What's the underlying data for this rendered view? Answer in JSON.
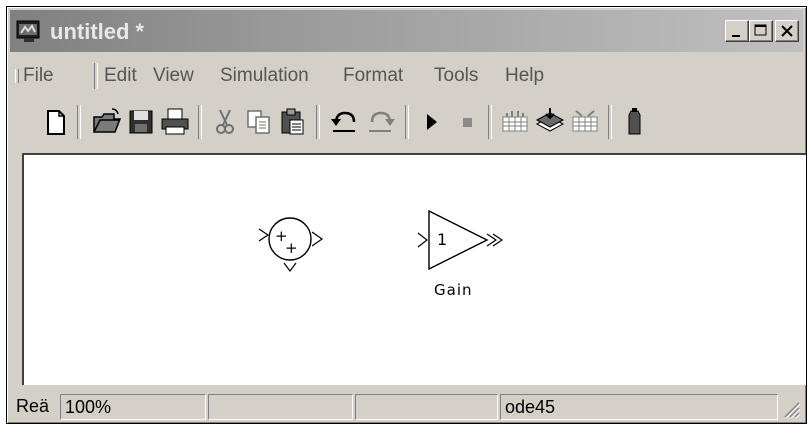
{
  "window": {
    "title": "untitled *"
  },
  "caption_buttons": [
    "minimize",
    "maximize",
    "close"
  ],
  "menubar": {
    "items": [
      "File",
      "Edit",
      "View",
      "Simulation",
      "Format",
      "Tools",
      "Help"
    ]
  },
  "toolbar": {
    "buttons": [
      "new-model",
      "open",
      "save",
      "print",
      "cut",
      "copy",
      "paste",
      "undo",
      "redo",
      "start-simulation",
      "stop-simulation",
      "build",
      "update-diagram",
      "build-subsystem",
      "library-browser"
    ]
  },
  "diagram": {
    "sum_block": {
      "signs": [
        "+",
        "+"
      ]
    },
    "gain_block": {
      "value": "1",
      "name": "Gain"
    }
  },
  "statusbar": {
    "status": "Reä",
    "zoom": "100%",
    "pane2": "",
    "pane3": "",
    "solver": "ode45"
  },
  "colors": {
    "face": "#d4d0c8",
    "title_inactive_start": "#808080",
    "title_inactive_end": "#c0c0c0",
    "canvas": "#ffffff"
  }
}
